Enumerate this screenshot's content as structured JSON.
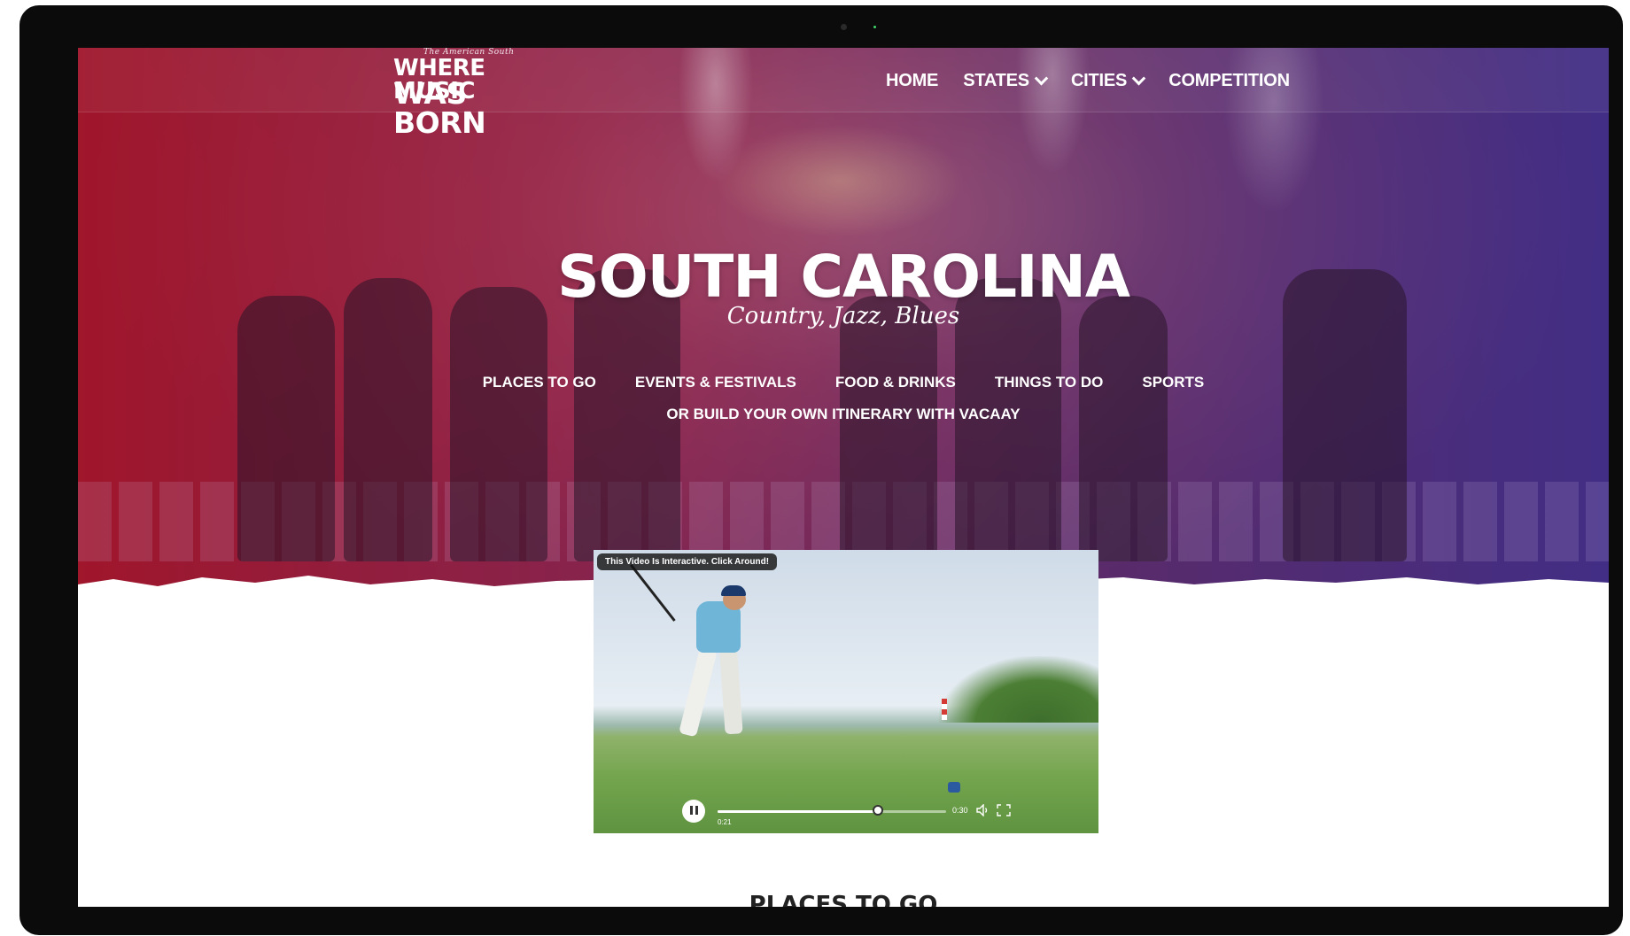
{
  "logo": {
    "tagline": "The American South",
    "line1": "WHERE MUSIC",
    "line2": "WAS BORN"
  },
  "nav": {
    "items": [
      {
        "label": "HOME",
        "dropdown": false
      },
      {
        "label": "STATES",
        "dropdown": true
      },
      {
        "label": "CITIES",
        "dropdown": true
      },
      {
        "label": "COMPETITION",
        "dropdown": false
      }
    ]
  },
  "hero": {
    "title": "SOUTH CAROLINA",
    "subtitle": "Country, Jazz, Blues",
    "categories": [
      "PLACES TO GO",
      "EVENTS & FESTIVALS",
      "FOOD & DRINKS",
      "THINGS TO DO",
      "SPORTS"
    ],
    "itinerary_link": "OR BUILD YOUR OWN ITINERARY WITH VACAAY"
  },
  "video": {
    "badge": "This Video Is Interactive. Click Around!",
    "current_time": "0:21",
    "duration": "0:30",
    "progress_fraction": 0.7,
    "state": "playing"
  },
  "next_section": {
    "heading": "PLACES TO GO"
  },
  "colors": {
    "hero_left": "#b0162c",
    "hero_right": "#463296",
    "text": "#ffffff"
  },
  "icons": [
    "chevron-down-icon",
    "pause-icon",
    "volume-icon",
    "fullscreen-icon"
  ]
}
